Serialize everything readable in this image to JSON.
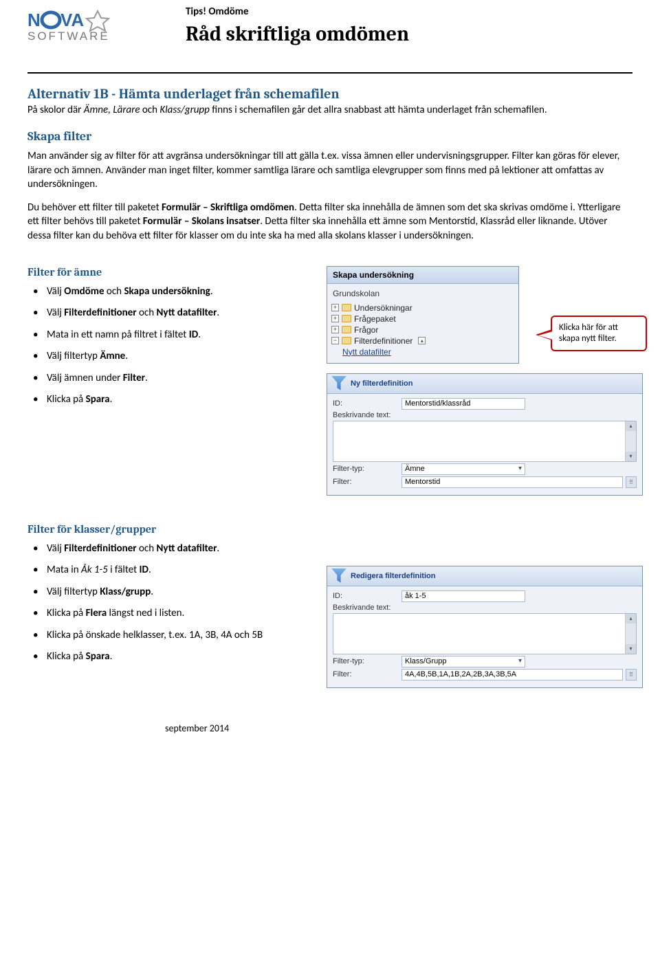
{
  "header": {
    "tips": "Tips! Omdöme",
    "title": "Råd skriftliga omdömen",
    "logo_alt": "Nova Software"
  },
  "s1": {
    "h": "Alternativ 1B - Hämta underlaget från schemafilen",
    "p_a": "På skolor där ",
    "p_b": "Ämne, Lärare",
    "p_c": " och ",
    "p_d": "Klass/grupp",
    "p_e": " finns i schemafilen går det allra snabbast att hämta underlaget från schemafilen."
  },
  "s2": {
    "h": "Skapa filter",
    "p1": "Man använder sig av filter för att avgränsa undersökningar till att gälla t.ex. vissa ämnen eller undervisningsgrupper. Filter kan göras för elever, lärare och ämnen. Använder man inget filter, kommer samtliga lärare och samtliga elevgrupper som finns med på lektioner att omfattas av undersökningen.",
    "p2_a": "Du behöver ett filter till paketet ",
    "p2_b": "Formulär – Skriftliga omdömen",
    "p2_c": ". Detta filter ska innehålla de ämnen som det ska skrivas omdöme i. Ytterligare ett filter behövs till paketet ",
    "p2_d": "Formulär – Skolans insatser",
    "p2_e": ". Detta filter ska innehålla ett ämne som Mentorstid, Klassråd eller liknande. Utöver dessa filter kan du behöva ett filter för klasser om du inte ska ha med alla skolans klasser i undersökningen."
  },
  "subj": {
    "h": "Filter för ämne",
    "b1_a": "Välj ",
    "b1_b": "Omdöme",
    "b1_c": " och ",
    "b1_d": "Skapa undersökning",
    "b1_e": ".",
    "b2_a": "Välj ",
    "b2_b": "Filterdefinitioner",
    "b2_c": " och ",
    "b2_d": "Nytt datafilter",
    "b2_e": ".",
    "b3_a": "Mata in ett namn på filtret i fältet ",
    "b3_b": "ID",
    "b3_c": ".",
    "b4_a": "Välj filtertyp ",
    "b4_b": "Ämne",
    "b4_c": ".",
    "b5_a": "Välj ämnen under ",
    "b5_b": "Filter",
    "b5_c": ".",
    "b6_a": "Klicka på ",
    "b6_b": "Spara",
    "b6_c": "."
  },
  "tree": {
    "title": "Skapa undersökning",
    "top": "Grundskolan",
    "n1": "Undersökningar",
    "n2": "Frågepaket",
    "n3": "Frågor",
    "n4": "Filterdefinitioner",
    "n5": "Nytt datafilter"
  },
  "callout": "Klicka här för att skapa nytt filter.",
  "form1": {
    "title": "Ny filterdefinition",
    "id_lbl": "ID:",
    "id_val": "Mentorstid/klassråd",
    "desc_lbl": "Beskrivande text:",
    "type_lbl": "Filter-typ:",
    "type_val": "Ämne",
    "filter_lbl": "Filter:",
    "filter_val": "Mentorstid"
  },
  "grp": {
    "h": "Filter för klasser/grupper",
    "b1_a": "Välj ",
    "b1_b": "Filterdefinitioner",
    "b1_c": " och ",
    "b1_d": "Nytt datafilter",
    "b1_e": ".",
    "b2_a": "Mata in ",
    "b2_b": "Åk 1-5",
    "b2_c": " i fältet ",
    "b2_d": "ID",
    "b2_e": ".",
    "b3_a": "Välj filtertyp ",
    "b3_b": "Klass/grupp",
    "b3_c": ".",
    "b4_a": "Klicka på ",
    "b4_b": "Flera",
    "b4_c": " längst ned i listen.",
    "b5": "Klicka på önskade helklasser, t.ex. 1A, 3B, 4A och 5B",
    "b6_a": "Klicka på ",
    "b6_b": "Spara",
    "b6_c": "."
  },
  "form2": {
    "title": "Redigera filterdefinition",
    "id_lbl": "ID:",
    "id_val": "åk 1-5",
    "desc_lbl": "Beskrivande text:",
    "type_lbl": "Filter-typ:",
    "type_val": "Klass/Grupp",
    "filter_lbl": "Filter:",
    "filter_val": "4A,4B,5B,1A,1B,2A,2B,3A,3B,5A"
  },
  "footer": "september 2014"
}
